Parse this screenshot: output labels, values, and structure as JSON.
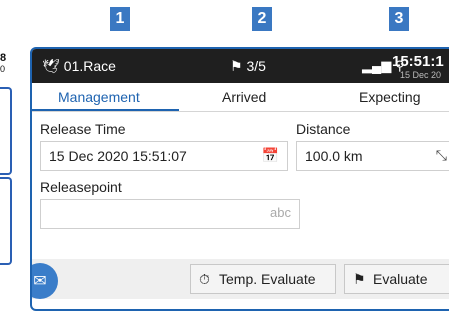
{
  "markers": [
    "1",
    "2",
    "3"
  ],
  "left_strip": {
    "num": "8",
    "sub": "0"
  },
  "statusbar": {
    "app_icon": "dove-icon",
    "app_name": "01.Race",
    "race_icon": "checkered-flag-icon",
    "race_count": "3/5",
    "signal_icon": "signal-location-icon",
    "time": "15:51:1",
    "date": "15 Dec 20"
  },
  "tabs": [
    {
      "label": "Management"
    },
    {
      "label": "Arrived"
    },
    {
      "label": "Expecting"
    }
  ],
  "form": {
    "release_time_label": "Release Time",
    "release_time_value": "15 Dec 2020 15:51:07",
    "release_time_icon": "calendar-clock-icon",
    "distance_label": "Distance",
    "distance_value": "100.0 km",
    "distance_icon": "route-icon",
    "releasepoint_label": "Releasepoint",
    "releasepoint_value": "",
    "releasepoint_kb": "abc"
  },
  "footer": {
    "temp_evaluate": "Temp. Evaluate",
    "evaluate": "Evaluate"
  },
  "colors": {
    "accent": "#1e63b0",
    "marker": "#3a78c2",
    "statusbar": "#1f1f1f"
  }
}
